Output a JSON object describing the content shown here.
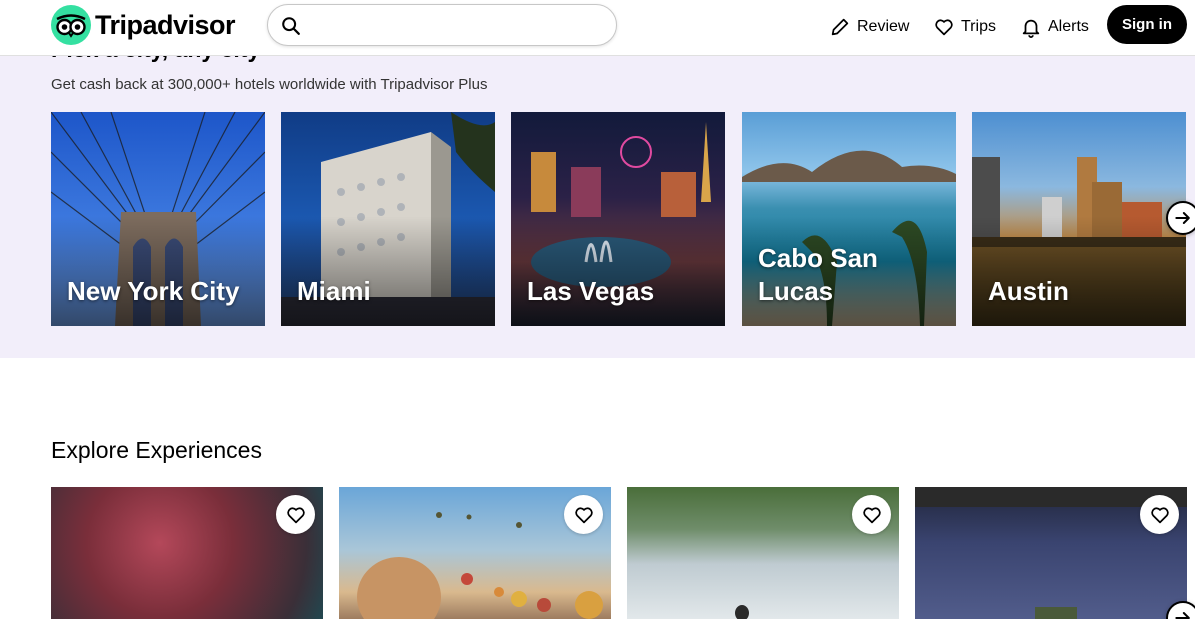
{
  "header": {
    "brand": "Tripadvisor",
    "search_placeholder": "",
    "nav": [
      {
        "label": "Review",
        "icon": "pencil-icon"
      },
      {
        "label": "Trips",
        "icon": "heart-icon"
      },
      {
        "label": "Alerts",
        "icon": "bell-icon"
      }
    ],
    "signin_label": "Sign in"
  },
  "cities_section": {
    "title": "Pick a city, any city",
    "subtitle": "Get cash back at 300,000+ hotels worldwide with Tripadvisor Plus",
    "cities": [
      {
        "name": "New York City"
      },
      {
        "name": "Miami"
      },
      {
        "name": "Las Vegas"
      },
      {
        "name": "Cabo San Lucas"
      },
      {
        "name": "Austin"
      }
    ]
  },
  "experiences_section": {
    "title": "Explore Experiences"
  },
  "colors": {
    "brand_green": "#34e0a1",
    "band_bg": "#f2eefa",
    "button_dark": "#000000"
  }
}
